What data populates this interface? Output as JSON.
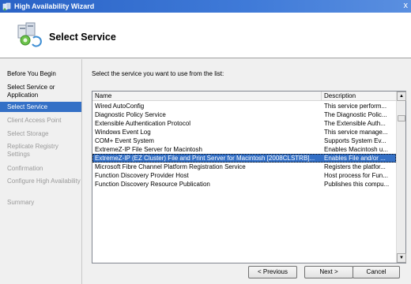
{
  "window": {
    "title": "High Availability Wizard",
    "close_glyph": "x"
  },
  "header": {
    "title": "Select Service"
  },
  "steps": [
    {
      "label": "Before You Begin",
      "state": "normal"
    },
    {
      "label": "Select Service or Application",
      "state": "normal"
    },
    {
      "label": "Select Service",
      "state": "active"
    },
    {
      "label": "Client Access Point",
      "state": "disabled"
    },
    {
      "label": "Select Storage",
      "state": "disabled"
    },
    {
      "label": "Replicate Registry Settings",
      "state": "disabled"
    },
    {
      "label": "Confirmation",
      "state": "disabled"
    },
    {
      "label": "Configure High Availability",
      "state": "disabled"
    },
    {
      "label": "Summary",
      "state": "disabled"
    }
  ],
  "main": {
    "prompt": "Select the service you want to use from the list:",
    "columns": {
      "name": "Name",
      "description": "Description"
    },
    "services": [
      {
        "name": "Wired AutoConfig",
        "description": "This service perform..."
      },
      {
        "name": "Diagnostic Policy Service",
        "description": "The Diagnostic Polic..."
      },
      {
        "name": "Extensible Authentication Protocol",
        "description": "The Extensible Auth..."
      },
      {
        "name": "Windows Event Log",
        "description": "This service manage..."
      },
      {
        "name": "COM+ Event System",
        "description": "Supports System Ev..."
      },
      {
        "name": "ExtremeZ-IP File Server for Macintosh",
        "description": "Enables Macintosh u..."
      },
      {
        "name": "ExtremeZ-IP (EZ Cluster) File and Print Server for Macintosh [2008CLSTRB]...",
        "description": "Enables File and/or ...",
        "selected": true
      },
      {
        "name": "Microsoft Fibre Channel Platform Registration Service",
        "description": "Registers the platfor..."
      },
      {
        "name": "Function Discovery Provider Host",
        "description": "Host process for Fun..."
      },
      {
        "name": "Function Discovery Resource Publication",
        "description": "Publishes this compu..."
      }
    ]
  },
  "buttons": {
    "previous": "< Previous",
    "next": "Next >",
    "cancel": "Cancel"
  },
  "icons": {
    "app": "wizard-app-icon",
    "header": "cluster-service-icon",
    "scroll_up": "scroll-up-icon",
    "scroll_down": "scroll-down-icon"
  },
  "colors": {
    "titlebar": "#2a63c6",
    "selection": "#3470c6",
    "disabled_text": "#9a9a9a"
  }
}
